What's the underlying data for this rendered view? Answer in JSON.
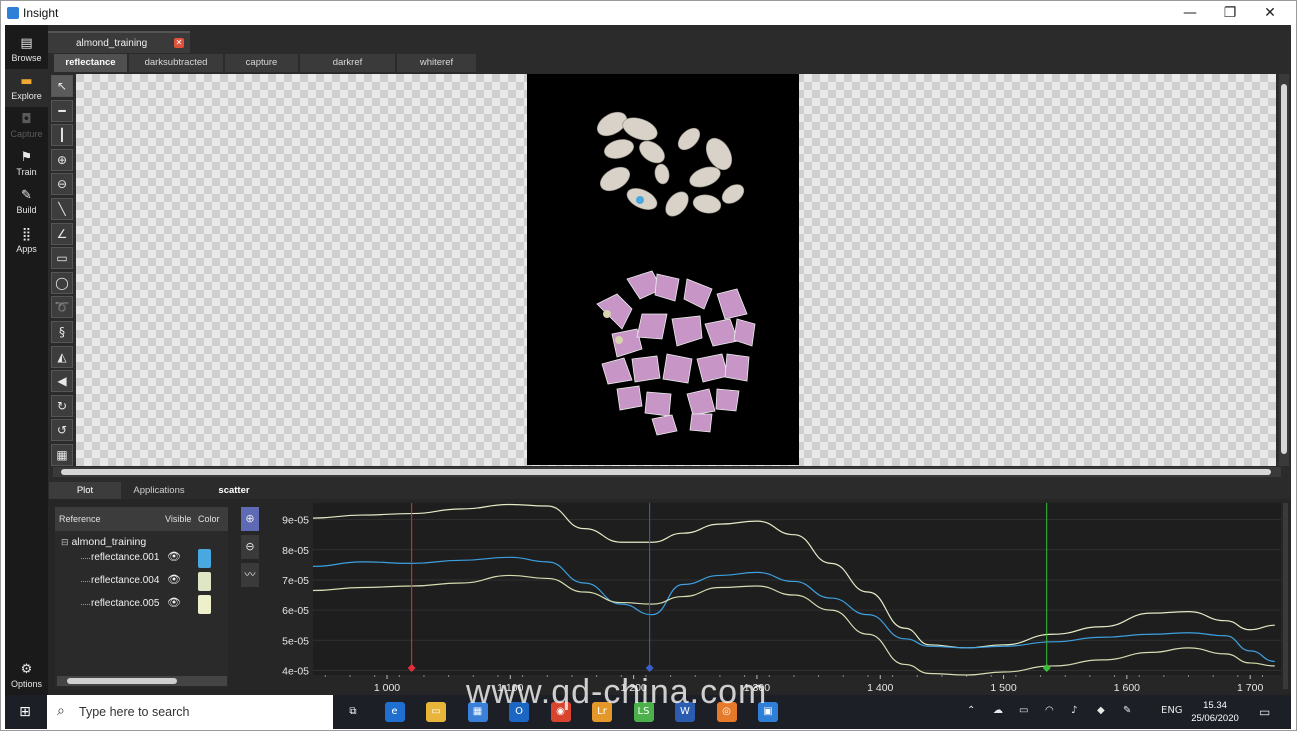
{
  "window": {
    "title": "Insight",
    "minimize_glyph": "—",
    "maximize_glyph": "❐",
    "close_glyph": "✕"
  },
  "leftbar": [
    {
      "label": "Browse",
      "icon": "browse-icon",
      "glyph": "▤"
    },
    {
      "label": "Explore",
      "icon": "explore-icon",
      "glyph": "▬"
    },
    {
      "label": "Capture",
      "icon": "camera-icon",
      "glyph": "◘"
    },
    {
      "label": "Train",
      "icon": "runner-icon",
      "glyph": "⚑"
    },
    {
      "label": "Build",
      "icon": "wrench-icon",
      "glyph": "✎"
    },
    {
      "label": "Apps",
      "icon": "grid-icon",
      "glyph": "⣿"
    },
    {
      "label": "Options",
      "icon": "gear-icon",
      "glyph": "⚙"
    }
  ],
  "file_tab": {
    "label": "almond_training",
    "close_glyph": "✕"
  },
  "subtabs": [
    "reflectance",
    "darksubtracted",
    "capture",
    "darkref",
    "whiteref"
  ],
  "active_subtab": "reflectance",
  "tools": [
    {
      "name": "pointer-tool",
      "glyph": "↖"
    },
    {
      "name": "horizontal-line-tool",
      "glyph": "━"
    },
    {
      "name": "vertical-line-tool",
      "glyph": "┃"
    },
    {
      "name": "zoom-in-tool",
      "glyph": "⊕"
    },
    {
      "name": "zoom-out-tool",
      "glyph": "⊖"
    },
    {
      "name": "wand-tool",
      "glyph": "╲"
    },
    {
      "name": "angle-tool",
      "glyph": "∠"
    },
    {
      "name": "rectangle-select-tool",
      "glyph": "▭"
    },
    {
      "name": "ellipse-select-tool",
      "glyph": "◯"
    },
    {
      "name": "lasso-tool",
      "glyph": "➰"
    },
    {
      "name": "freehand-tool",
      "glyph": "§"
    },
    {
      "name": "flip-horizontal-tool",
      "glyph": "◭"
    },
    {
      "name": "flip-vertical-tool",
      "glyph": "◀"
    },
    {
      "name": "rotate-cw-tool",
      "glyph": "↻"
    },
    {
      "name": "rotate-ccw-tool",
      "glyph": "↺"
    },
    {
      "name": "colormap-tool",
      "glyph": "▦"
    }
  ],
  "bottom_tabs": [
    "Plot",
    "Applications",
    "scatter"
  ],
  "reference_table": {
    "headers": [
      "Reference",
      "Visible",
      "Color"
    ],
    "root": "almond_training",
    "rows": [
      {
        "label": "reflectance.001",
        "color": "#4aa8e0"
      },
      {
        "label": "reflectance.004",
        "color": "#dfe6c6"
      },
      {
        "label": "reflectance.005",
        "color": "#eef0cc"
      }
    ],
    "eye_glyph": "👁",
    "collapse_glyph": "⊟"
  },
  "plot_tools": [
    {
      "name": "plot-zoom-in-button",
      "glyph": "⊕"
    },
    {
      "name": "plot-zoom-out-button",
      "glyph": "⊖"
    },
    {
      "name": "plot-autoscale-button",
      "glyph": "〰"
    }
  ],
  "chart_data": {
    "type": "line",
    "x_ticks": [
      "1 000",
      "1 100",
      "1 200",
      "1 300",
      "1 400",
      "1 500",
      "1 600",
      "1 700"
    ],
    "y_ticks": [
      "9e-05",
      "8e-05",
      "7e-05",
      "6e-05",
      "5e-05",
      "4e-05"
    ],
    "xlim": [
      940,
      1725
    ],
    "ylim": [
      3.85e-05,
      9.55e-05
    ],
    "x": [
      940,
      980,
      1020,
      1060,
      1100,
      1130,
      1160,
      1190,
      1215,
      1240,
      1270,
      1300,
      1330,
      1360,
      1390,
      1420,
      1440,
      1470,
      1500,
      1540,
      1580,
      1620,
      1650,
      1680,
      1700,
      1720
    ],
    "series": [
      {
        "color": "#e2ecc6",
        "values": [
          9.05e-05,
          9.15e-05,
          9.2e-05,
          9.35e-05,
          9.5e-05,
          9.45e-05,
          8.7e-05,
          8.25e-05,
          8.25e-05,
          8.55e-05,
          8.85e-05,
          8.95e-05,
          8.5e-05,
          7.55e-05,
          6.6e-05,
          5.4e-05,
          4.85e-05,
          4.75e-05,
          4.85e-05,
          5.2e-05,
          5.45e-05,
          5.9e-05,
          5.95e-05,
          5.65e-05,
          5.35e-05,
          5.5e-05
        ]
      },
      {
        "color": "#3da0e0",
        "values": [
          7.45e-05,
          7.6e-05,
          7.55e-05,
          7.65e-05,
          7.75e-05,
          7.6e-05,
          6.9e-05,
          6.2e-05,
          5.85e-05,
          6.85e-05,
          7.15e-05,
          7.25e-05,
          6.95e-05,
          6.4e-05,
          5.85e-05,
          5.05e-05,
          4.8e-05,
          4.75e-05,
          4.8e-05,
          4.95e-05,
          5.1e-05,
          5.2e-05,
          5.25e-05,
          5.15e-05,
          4.65e-05,
          4.3e-05
        ]
      },
      {
        "color": "#d4dcb0",
        "values": [
          6.65e-05,
          6.75e-05,
          6.8e-05,
          6.9e-05,
          7.15e-05,
          7.05e-05,
          6.6e-05,
          6.25e-05,
          6.2e-05,
          6.45e-05,
          6.75e-05,
          6.8e-05,
          6.5e-05,
          6e-05,
          5.2e-05,
          4.2e-05,
          3.9e-05,
          3.85e-05,
          3.95e-05,
          4.15e-05,
          4.35e-05,
          4.6e-05,
          4.75e-05,
          4.55e-05,
          4.25e-05,
          4.15e-05
        ]
      }
    ],
    "markers": [
      {
        "x": 1020,
        "color": "#e0303a"
      },
      {
        "x": 1213,
        "color": "#3a5fc8"
      },
      {
        "x": 1535,
        "color": "#3bbf3b"
      }
    ]
  },
  "taskbar": {
    "search_placeholder": "Type here to search",
    "search_glyph": "⌕",
    "lang": "ENG",
    "time": "15.34",
    "date": "25/06/2020",
    "apps": [
      {
        "icon": "task-view-icon",
        "glyph": "⧉",
        "color": "#1c1f26"
      },
      {
        "icon": "edge-icon",
        "glyph": "e",
        "color": "#1f6fd0"
      },
      {
        "icon": "file-explorer-icon",
        "glyph": "▭",
        "color": "#e8b43a"
      },
      {
        "icon": "store-icon",
        "glyph": "▦",
        "color": "#3a7fd8"
      },
      {
        "icon": "outlook-icon",
        "glyph": "O",
        "color": "#1c66c4"
      },
      {
        "icon": "chrome-icon",
        "glyph": "◉",
        "color": "#d9442f"
      },
      {
        "icon": "lightroom-icon",
        "glyph": "Lr",
        "color": "#e5982a"
      },
      {
        "icon": "green-app-icon",
        "glyph": "LS",
        "color": "#4cb14a"
      },
      {
        "icon": "word-icon",
        "glyph": "W",
        "color": "#2b5cb0"
      },
      {
        "icon": "orange-app-icon",
        "glyph": "◎",
        "color": "#e47a2a"
      },
      {
        "icon": "insight-icon",
        "glyph": "▣",
        "color": "#2f7fd8"
      }
    ],
    "tray": [
      {
        "icon": "chevron-up-icon",
        "glyph": "⌃"
      },
      {
        "icon": "onedrive-icon",
        "glyph": "☁"
      },
      {
        "icon": "battery-icon",
        "glyph": "▭"
      },
      {
        "icon": "wifi-icon",
        "glyph": "◠"
      },
      {
        "icon": "volume-icon",
        "glyph": "♪"
      },
      {
        "icon": "dropbox-icon",
        "glyph": "◆"
      },
      {
        "icon": "pen-icon",
        "glyph": "✎"
      }
    ],
    "notification_glyph": "▭"
  },
  "watermark": "www.qd-china.com"
}
